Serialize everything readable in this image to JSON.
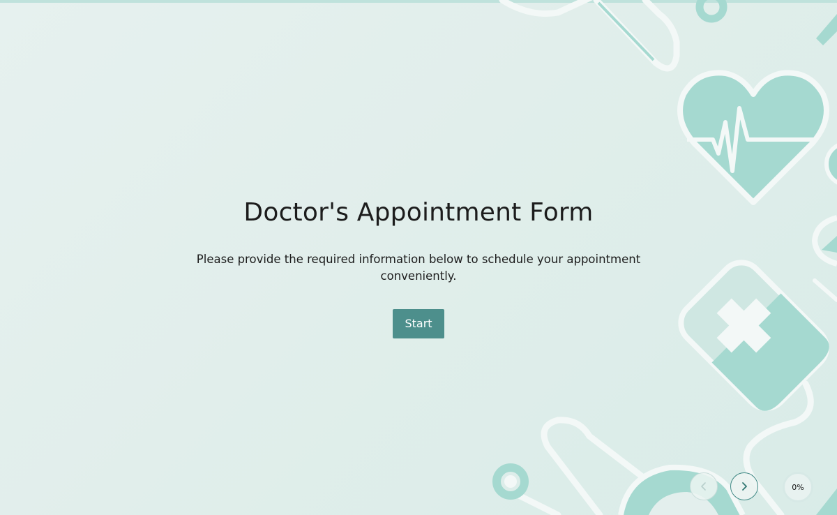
{
  "form": {
    "title": "Doctor's Appointment Form",
    "subtitle": "Please provide the required information below to schedule your appointment conveniently.",
    "start_label": "Start"
  },
  "navigation": {
    "prev_icon": "chevron-left-icon",
    "next_icon": "chevron-right-icon"
  },
  "progress": {
    "value": 0,
    "label": "0%"
  },
  "colors": {
    "accent": "#4d8f8c",
    "decor_fill": "#a5d9d0",
    "decor_stroke": "#f3f8f7",
    "background": "#e3efed"
  }
}
